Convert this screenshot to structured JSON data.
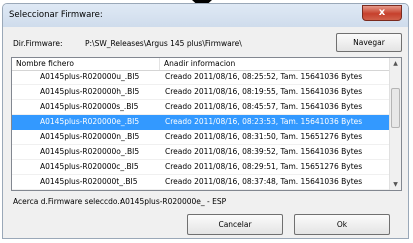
{
  "dialog": {
    "title": "Seleccionar Firmware:",
    "close_glyph": "x",
    "dir_label": "Dir.Firmware:",
    "dir_path": "P:\\SW_Releases\\Argus 145 plus\\Firmware\\",
    "browse_label": "Navegar",
    "columns": [
      "Nombre fichero",
      "Anadir informacion"
    ],
    "rows": [
      {
        "name": "A0145plus-R020000u_.BI5",
        "info": "Creado 2011/08/16, 08:25:52, Tam. 15641036 Bytes",
        "selected": false
      },
      {
        "name": "A0145plus-R020000h_.BI5",
        "info": "Creado 2011/08/16, 08:19:55, Tam. 15641036 Bytes",
        "selected": false
      },
      {
        "name": "A0145plus-R020000s_.BI5",
        "info": "Creado 2011/08/16, 08:45:57, Tam. 15641036 Bytes",
        "selected": false
      },
      {
        "name": "A0145plus-R020000e_.BI5",
        "info": "Creado 2011/08/16, 08:23:53, Tam. 15641036 Bytes",
        "selected": true
      },
      {
        "name": "A0145plus-R020000n_.BI5",
        "info": "Creado 2011/08/16, 08:31:50, Tam. 15651276 Bytes",
        "selected": false
      },
      {
        "name": "A0145plus-R020000o_.BI5",
        "info": "Creado 2011/08/16, 08:39:52, Tam. 15641036 Bytes",
        "selected": false
      },
      {
        "name": "A0145plus-R020000c_.BI5",
        "info": "Creado 2011/08/16, 08:29:51, Tam. 15651276 Bytes",
        "selected": false
      },
      {
        "name": "A0145plus-R020000t_.BI5",
        "info": "Creado 2011/08/16, 08:37:48, Tam. 15641036 Bytes",
        "selected": false
      }
    ],
    "about_label": "Acerca d.Firmware seleccdo.:",
    "about_value": "A0145plus-R020000e_ - ESP",
    "cancel_label": "Cancelar",
    "ok_label": "Ok",
    "colors": {
      "selection": "#3399ff",
      "titlebar": "#dfe9f5",
      "close": "#c6402c"
    }
  }
}
